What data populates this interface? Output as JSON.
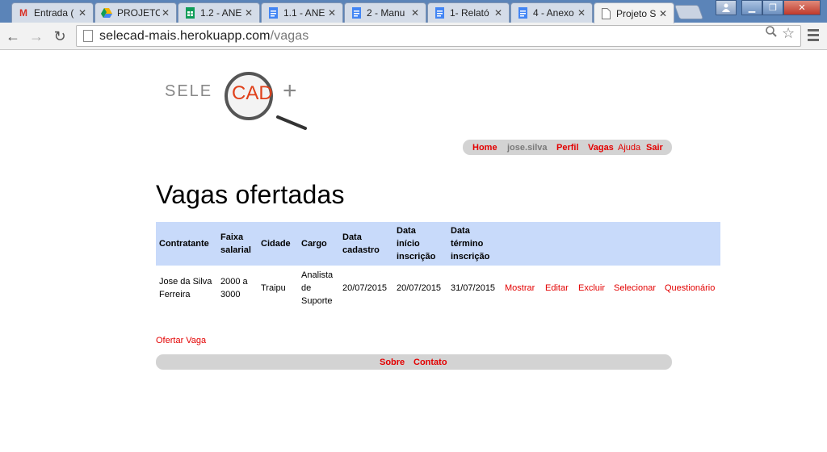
{
  "browser": {
    "tabs": [
      {
        "label": "Entrada (",
        "icon": "gmail-icon"
      },
      {
        "label": "PROJETO",
        "icon": "drive-icon"
      },
      {
        "label": "1.2 - ANE",
        "icon": "sheets-icon"
      },
      {
        "label": "1.1 - ANE",
        "icon": "docs-icon"
      },
      {
        "label": "2 - Manu",
        "icon": "docs-icon"
      },
      {
        "label": "1- Relató",
        "icon": "docs-icon"
      },
      {
        "label": "4 - Anexo",
        "icon": "docs-icon"
      },
      {
        "label": "Projeto S",
        "icon": "page-icon",
        "active": true
      }
    ],
    "url_host": "selecad-mais.herokuapp.com",
    "url_path": "/vagas"
  },
  "logo": {
    "left_text": "SELE",
    "lens_text": "CAD",
    "plus": "+"
  },
  "topnav": {
    "home": "Home",
    "user": "jose.silva",
    "perfil": "Perfil",
    "vagas": "Vagas",
    "ajuda": "Ajuda",
    "sair": "Sair"
  },
  "page_title": "Vagas ofertadas",
  "table": {
    "headers": [
      [
        "Contratante"
      ],
      [
        "Faixa",
        "salarial"
      ],
      [
        "Cidade"
      ],
      [
        "Cargo"
      ],
      [
        "Data",
        "cadastro"
      ],
      [
        "Data",
        "início",
        "inscrição"
      ],
      [
        "Data",
        "término",
        "inscrição"
      ]
    ],
    "rows": [
      {
        "contratante": [
          "Jose da Silva",
          "Ferreira"
        ],
        "faixa": [
          "2000 a",
          "3000"
        ],
        "cidade": "Traipu",
        "cargo": [
          "Analista",
          "de",
          "Suporte"
        ],
        "data_cadastro": "20/07/2015",
        "data_inicio": "20/07/2015",
        "data_termino": "31/07/2015",
        "actions": {
          "mostrar": "Mostrar",
          "editar": "Editar",
          "excluir": "Excluir",
          "selecionar": "Selecionar",
          "questionario": "Questionário"
        }
      }
    ]
  },
  "offer_link": "Ofertar Vaga",
  "footer": {
    "sobre": "Sobre",
    "contato": "Contato"
  },
  "colors": {
    "accent_red": "#e30000",
    "table_header": "#c8dafa",
    "nav_bar": "#d3d3d3",
    "logo_red": "#e0401a"
  }
}
